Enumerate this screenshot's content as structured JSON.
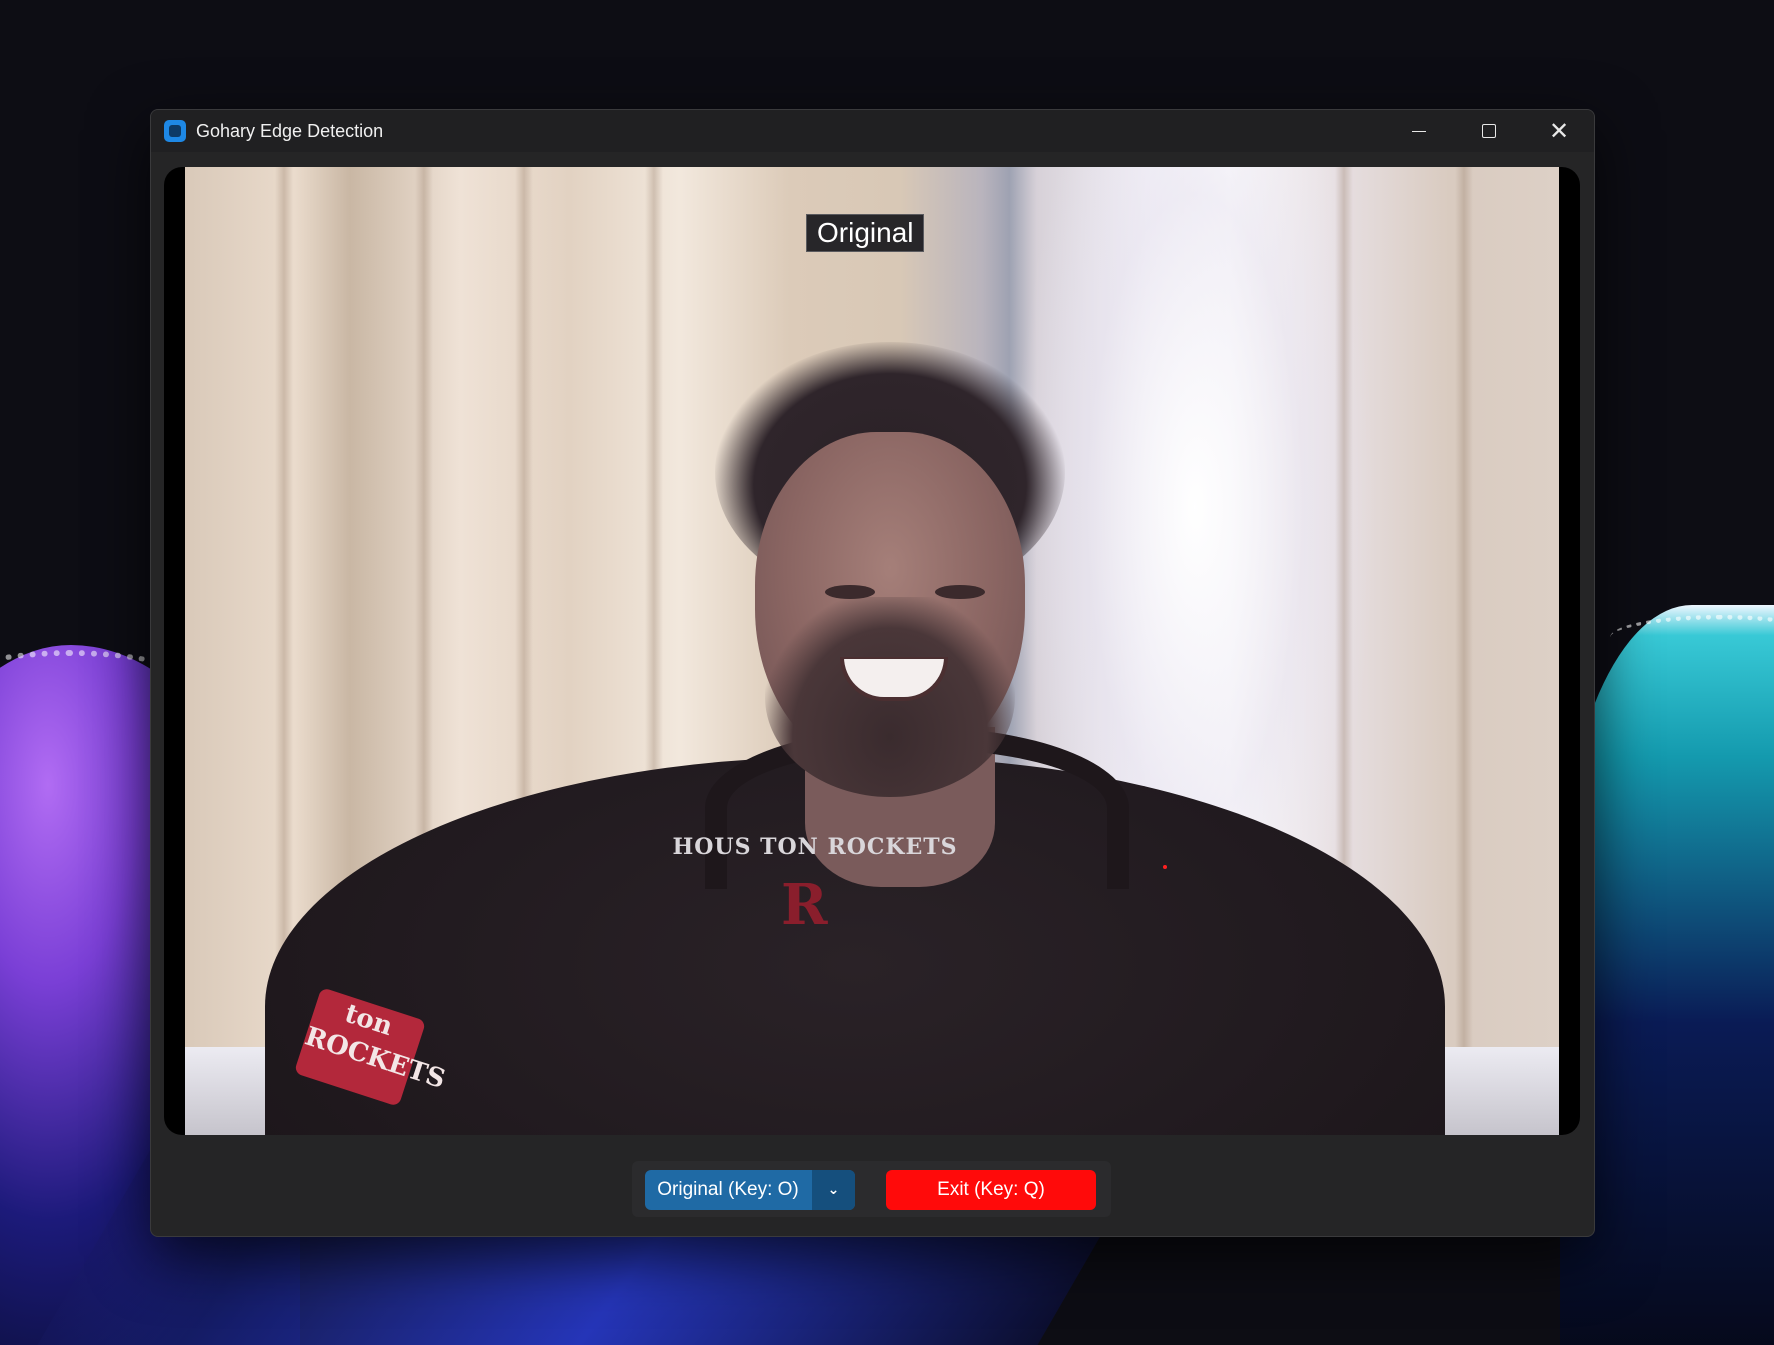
{
  "window": {
    "title": "Gohary Edge Detection",
    "controls": {
      "minimize_icon": "minimize-icon",
      "maximize_icon": "maximize-icon",
      "close_icon": "close-icon"
    }
  },
  "video": {
    "overlay_label": "Original",
    "shirt_text": "HOUS TON ROCKETS",
    "logo_letter": "R",
    "sleeve_text": "ton ROCKETS"
  },
  "controls": {
    "mode_select": {
      "selected": "Original (Key: O)",
      "arrow": "⌄"
    },
    "exit_button": "Exit (Key: Q)"
  },
  "colors": {
    "accent": "#1f6aa5",
    "exit": "#ff0a0a",
    "window_bg": "#252526"
  }
}
